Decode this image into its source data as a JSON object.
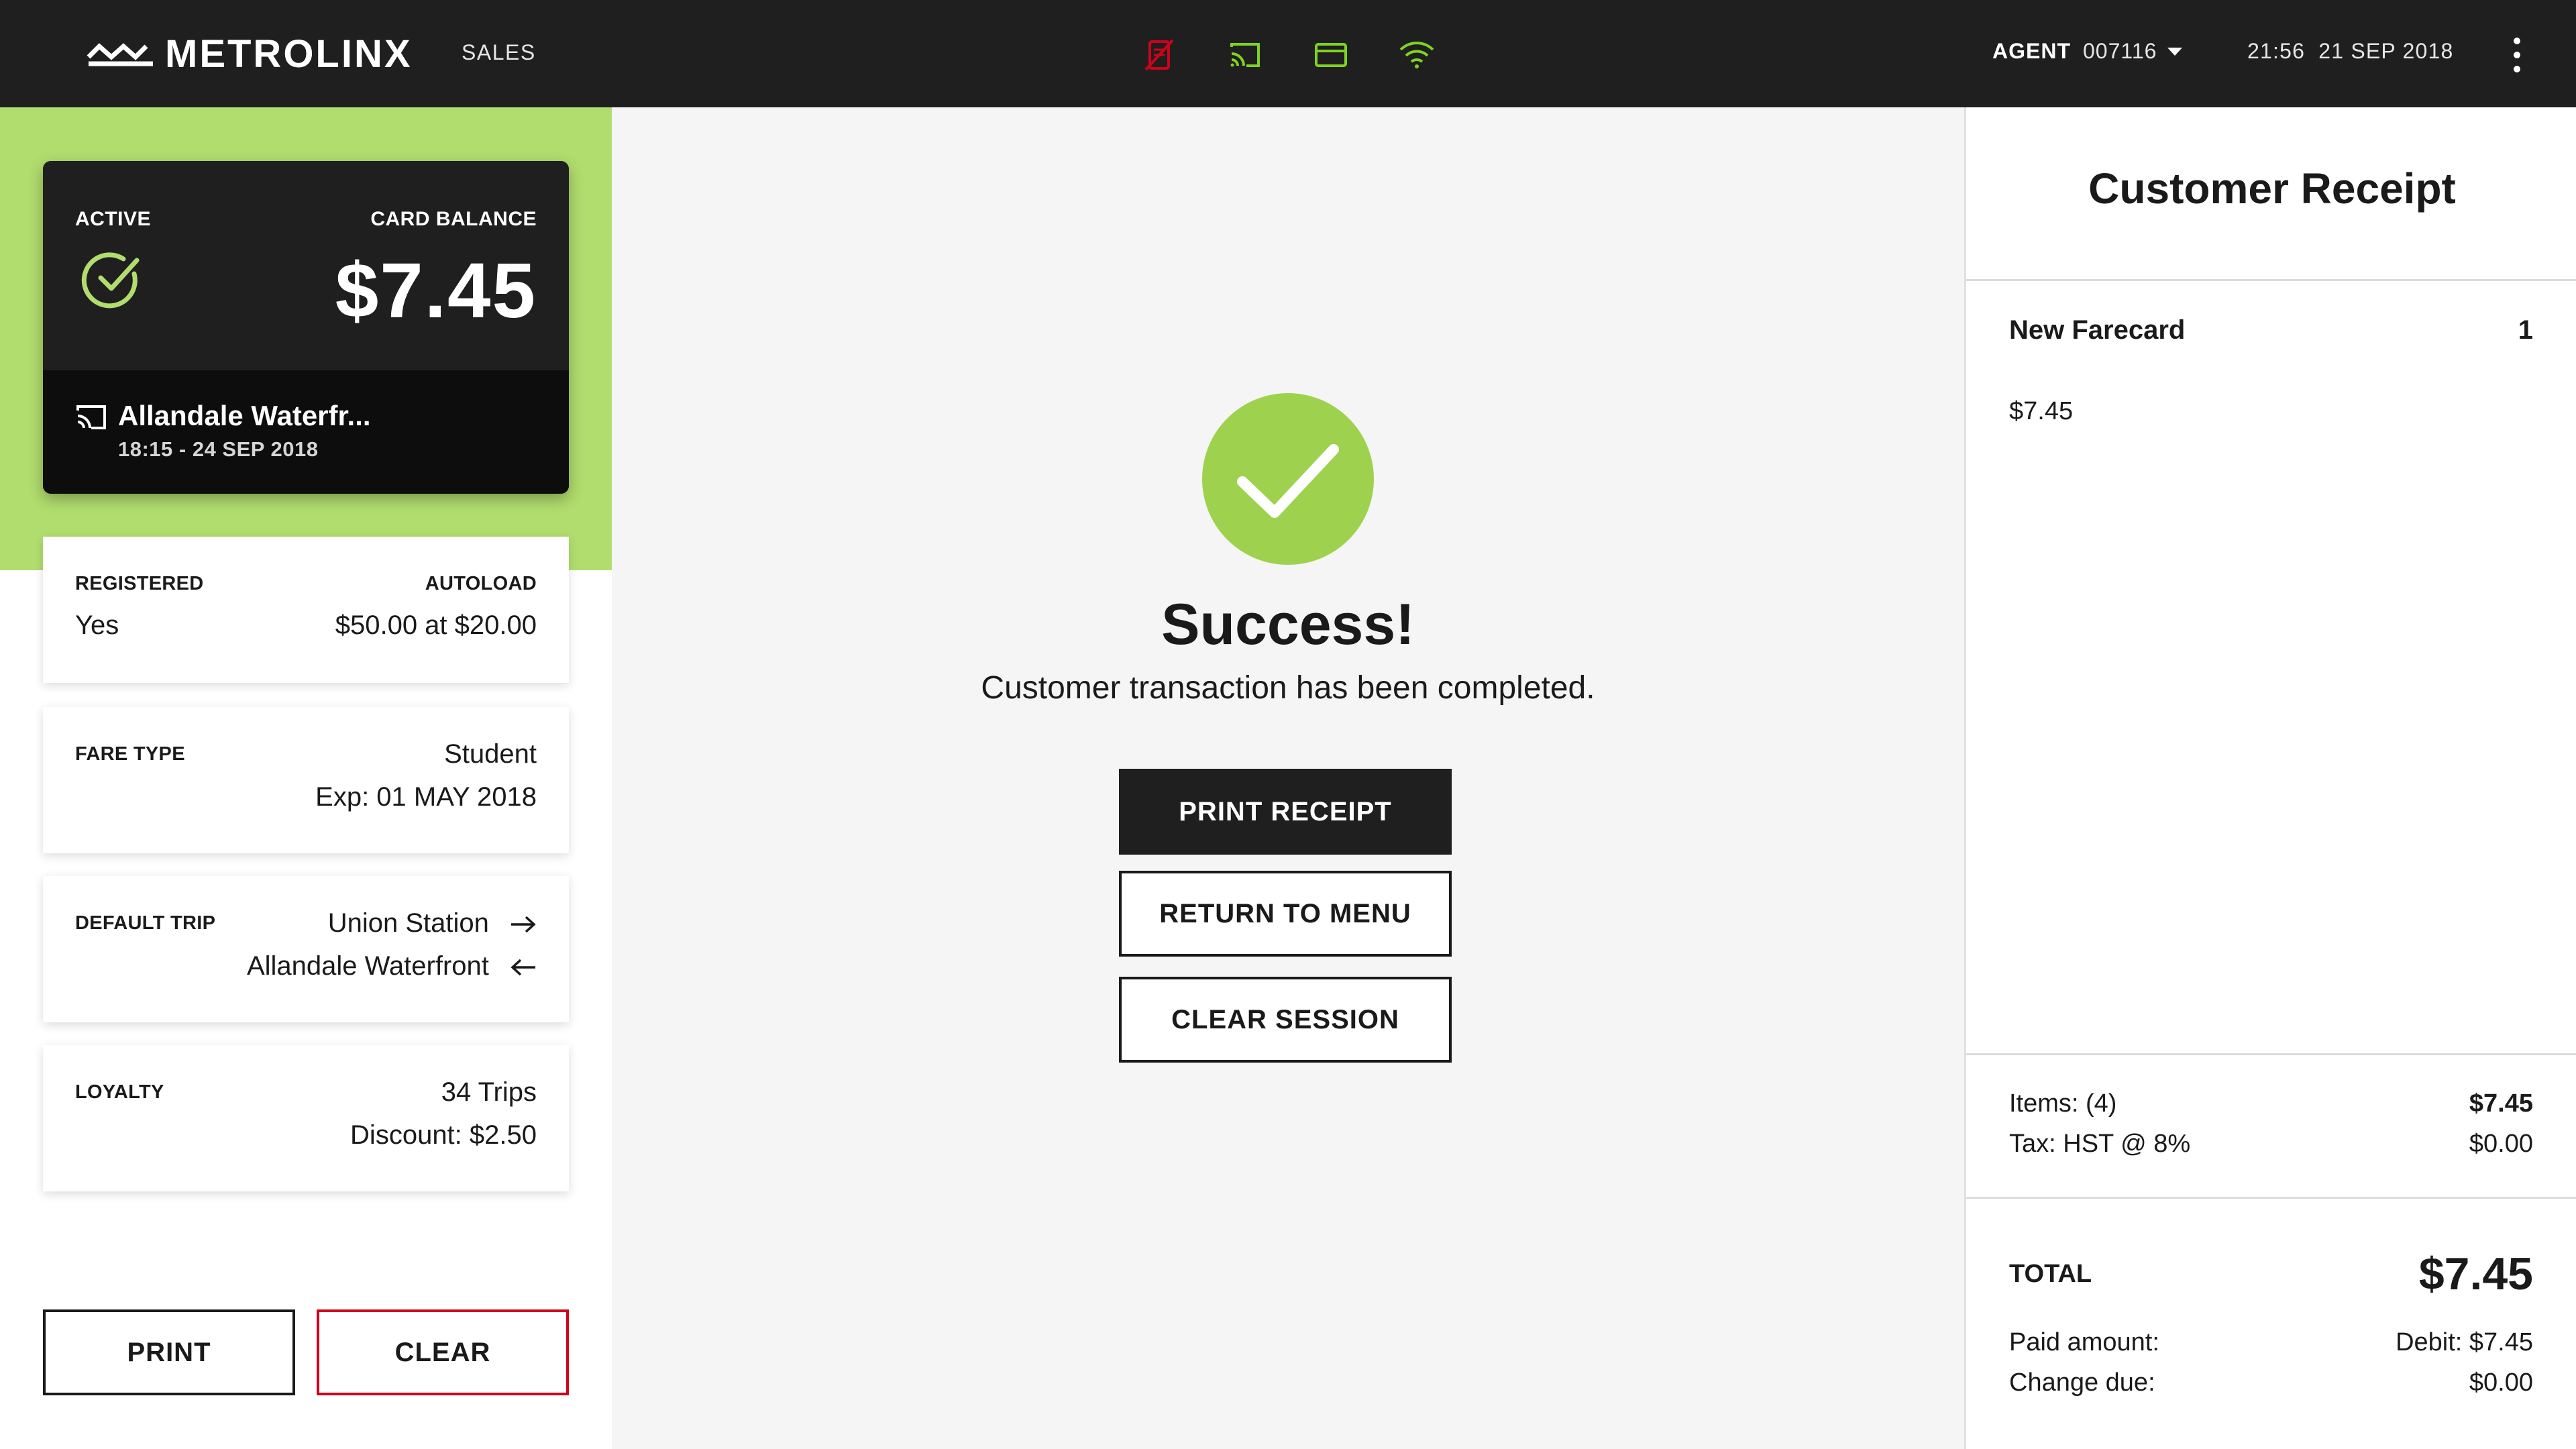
{
  "header": {
    "brand": "METROLINX",
    "section": "SALES",
    "status_icons": [
      "printer-offline-icon",
      "cast-icon",
      "card-reader-icon",
      "wifi-icon"
    ],
    "status_colors": {
      "offline": "#d0021b",
      "ok": "#7ed321"
    },
    "agent_label": "AGENT",
    "agent_id": "007116",
    "time": "21:56",
    "date": "21 SEP 2018"
  },
  "card": {
    "status": "ACTIVE",
    "balance_label": "CARD BALANCE",
    "balance": "$7.45",
    "last_station": "Allandale Waterfr...",
    "last_tap": "18:15 - 24 SEP 2018"
  },
  "info": {
    "registered_label": "REGISTERED",
    "registered_value": "Yes",
    "autoload_label": "AUTOLOAD",
    "autoload_value": "$50.00 at $20.00",
    "fare_type_label": "FARE TYPE",
    "fare_type_value": "Student",
    "fare_type_exp": "Exp: 01 MAY 2018",
    "default_trip_label": "DEFAULT TRIP",
    "trip_from": "Union Station",
    "trip_to": "Allandale Waterfront",
    "loyalty_label": "LOYALTY",
    "loyalty_trips": "34 Trips",
    "loyalty_discount": "Discount: $2.50"
  },
  "left_actions": {
    "print": "PRINT",
    "clear": "CLEAR"
  },
  "center": {
    "title": "Success!",
    "subtitle": "Customer transaction has been completed.",
    "print_receipt": "PRINT RECEIPT",
    "return_menu": "RETURN TO MENU",
    "clear_session": "CLEAR SESSION"
  },
  "receipt": {
    "title": "Customer Receipt",
    "item_name": "New Farecard",
    "item_qty": "1",
    "item_price": "$7.45",
    "items_label": "Items: (4)",
    "items_value": "$7.45",
    "tax_label": "Tax: HST @ 8%",
    "tax_value": "$0.00",
    "total_label": "TOTAL",
    "total_value": "$7.45",
    "paid_label": "Paid amount:",
    "paid_value": "Debit: $7.45",
    "change_label": "Change due:",
    "change_value": "$0.00"
  }
}
